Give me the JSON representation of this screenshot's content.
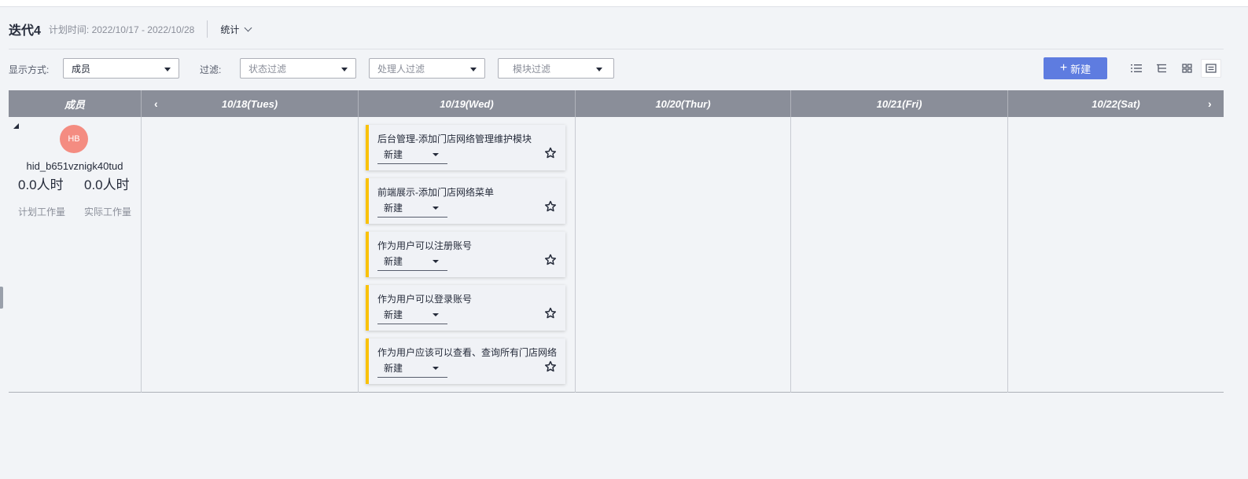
{
  "header": {
    "iteration_name": "迭代4",
    "plan_time": "计划时间: 2022/10/17 - 2022/10/28",
    "stats_label": "统计"
  },
  "filters": {
    "display_label": "显示方式:",
    "display_value": "成员",
    "filter_label": "过滤:",
    "status_placeholder": "状态过滤",
    "assignee_placeholder": "处理人过滤",
    "module_placeholder": "模块过滤"
  },
  "toolbar": {
    "new_button_label": "新建",
    "view_icons": [
      "list-view-icon",
      "tree-view-icon",
      "card-view-icon",
      "calendar-view-icon"
    ]
  },
  "board": {
    "member_header": "成员",
    "days": [
      "10/18(Tues)",
      "10/19(Wed)",
      "10/20(Thur)",
      "10/21(Fri)",
      "10/22(Sat)"
    ],
    "member": {
      "avatar_initials": "HB",
      "name": "hid_b651vznigk40tud",
      "planned_hours": "0.0人时",
      "actual_hours": "0.0人时",
      "planned_label": "计划工作量",
      "actual_label": "实际工作量"
    },
    "cards": [
      {
        "title": "后台管理-添加门店网络管理维护模块",
        "status": "新建"
      },
      {
        "title": "前端展示-添加门店网络菜单",
        "status": "新建"
      },
      {
        "title": "作为用户可以注册账号",
        "status": "新建"
      },
      {
        "title": "作为用户可以登录账号",
        "status": "新建"
      },
      {
        "title": "作为用户应该可以查看、查询所有门店网络",
        "status": "新建"
      }
    ]
  },
  "colors": {
    "primary": "#5e7ce0",
    "header_bg": "#8a8e99",
    "card_accent": "#fac20a",
    "avatar_bg": "#f48c81"
  }
}
